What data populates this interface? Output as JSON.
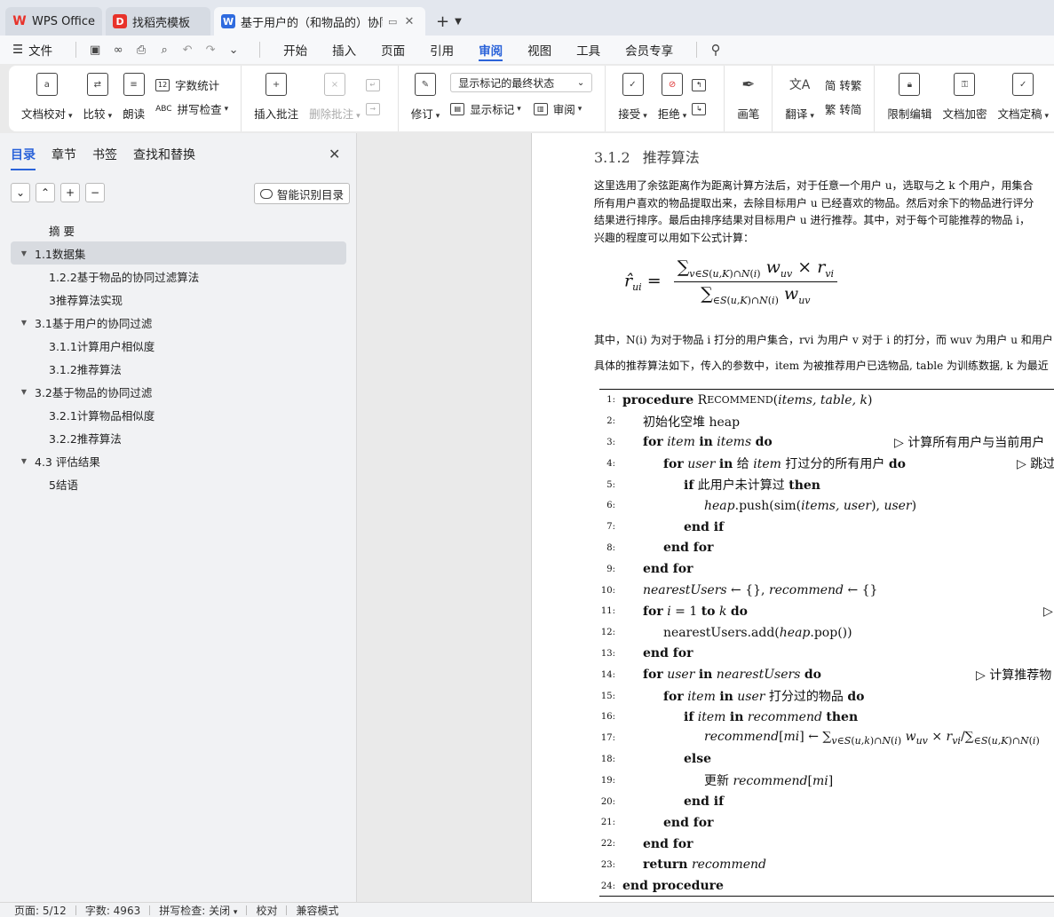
{
  "tabs": [
    {
      "label": "WPS Office",
      "icon": "wps-logo-icon",
      "color": "#e8322a"
    },
    {
      "label": "找稻壳模板",
      "icon": "docer-logo-icon",
      "color": "#e8322a"
    },
    {
      "label": "基于用户的（和物品的）协同过",
      "icon": "writer-doc-icon",
      "color": "#2f6bdf"
    }
  ],
  "menubar": {
    "file": "文件",
    "tabs": [
      "开始",
      "插入",
      "页面",
      "引用",
      "审阅",
      "视图",
      "工具",
      "会员专享"
    ],
    "active": "审阅"
  },
  "ribbon": {
    "proofread": "文档校对",
    "compare": "比较",
    "read_aloud": "朗读",
    "word_count": "字数统计",
    "spell_check": "拼写检查",
    "insert_comment": "插入批注",
    "delete_comment": "删除批注",
    "track_changes": "修订",
    "markup_state": "显示标记的最终状态",
    "show_markup": "显示标记",
    "review": "审阅",
    "accept": "接受",
    "reject": "拒绝",
    "pen": "画笔",
    "translate": "翻译",
    "to_traditional": "转繁",
    "to_simplified": "转简",
    "restrict_editing": "限制编辑",
    "encrypt": "文档加密",
    "finalize": "文档定稿"
  },
  "sidebar": {
    "tabs": [
      "目录",
      "章节",
      "书签",
      "查找和替换"
    ],
    "active_tab": "目录",
    "smart_button": "智能识别目录",
    "toc": [
      {
        "label": "摘 要",
        "level": 2,
        "arrow": false,
        "selected": false
      },
      {
        "label": "1.1数据集",
        "level": 1,
        "arrow": true,
        "selected": true
      },
      {
        "label": "1.2.2基于物品的协同过滤算法",
        "level": 2,
        "arrow": false,
        "selected": false
      },
      {
        "label": "3推荐算法实现",
        "level": 2,
        "arrow": false,
        "selected": false
      },
      {
        "label": "3.1基于用户的协同过滤",
        "level": 1,
        "arrow": true,
        "selected": false
      },
      {
        "label": "3.1.1计算用户相似度",
        "level": 2,
        "arrow": false,
        "selected": false
      },
      {
        "label": "3.1.2推荐算法",
        "level": 2,
        "arrow": false,
        "selected": false
      },
      {
        "label": "3.2基于物品的协同过滤",
        "level": 1,
        "arrow": true,
        "selected": false
      },
      {
        "label": "3.2.1计算物品相似度",
        "level": 2,
        "arrow": false,
        "selected": false
      },
      {
        "label": "3.2.2推荐算法",
        "level": 2,
        "arrow": false,
        "selected": false
      },
      {
        "label": "4.3 评估结果",
        "level": 1,
        "arrow": true,
        "selected": false
      },
      {
        "label": "5结语",
        "level": 2,
        "arrow": false,
        "selected": false
      }
    ]
  },
  "document": {
    "section_num": "3.1.2",
    "section_title": "推荐算法",
    "para1": [
      "这里选用了余弦距离作为距离计算方法后，对于任意一个用户 u，选取与之 k 个用户，用集合",
      "所有用户喜欢的物品提取出来，去除目标用户 u 已经喜欢的物品。然后对余下的物品进行评分",
      "结果进行排序。最后由排序结果对目标用户 u 进行推荐。其中，对于每个可能推荐的物品 i，",
      "兴趣的程度可以用如下公式计算："
    ],
    "para2": "其中，N(i) 为对于物品 i 打分的用户集合，rvi 为用户 v 对于 i 的打分，而 wuv 为用户 u 和用户",
    "para3": "具体的推荐算法如下，传入的参数中，item 为被推荐用户已选物品, table 为训练数据, k 为最近"
  },
  "algorithm": {
    "line_numbers": [
      "1:",
      "2:",
      "3:",
      "4:",
      "5:",
      "6:",
      "7:",
      "8:",
      "9:",
      "10:",
      "11:",
      "12:",
      "13:",
      "14:",
      "15:",
      "16:",
      "17:",
      "18:",
      "19:",
      "20:",
      "21:",
      "22:",
      "23:",
      "24:"
    ],
    "comments": {
      "l3": "▷ 计算所有用户与当前用户",
      "l4": "▷ 跳过",
      "l11": "▷",
      "l14": "▷ 计算推荐物"
    },
    "kw": {
      "init_heap": "初始化空堆 heap",
      "give": "给",
      "rated_all_users": "打过分的所有用户",
      "not_computed": "此用户未计算过",
      "rated_items": "打分过的物品",
      "update": "更新"
    }
  },
  "status": {
    "page": "页面: 5/12",
    "words": "字数: 4963",
    "spell": "拼写检查: 关闭",
    "proof": "校对",
    "compat": "兼容模式"
  }
}
